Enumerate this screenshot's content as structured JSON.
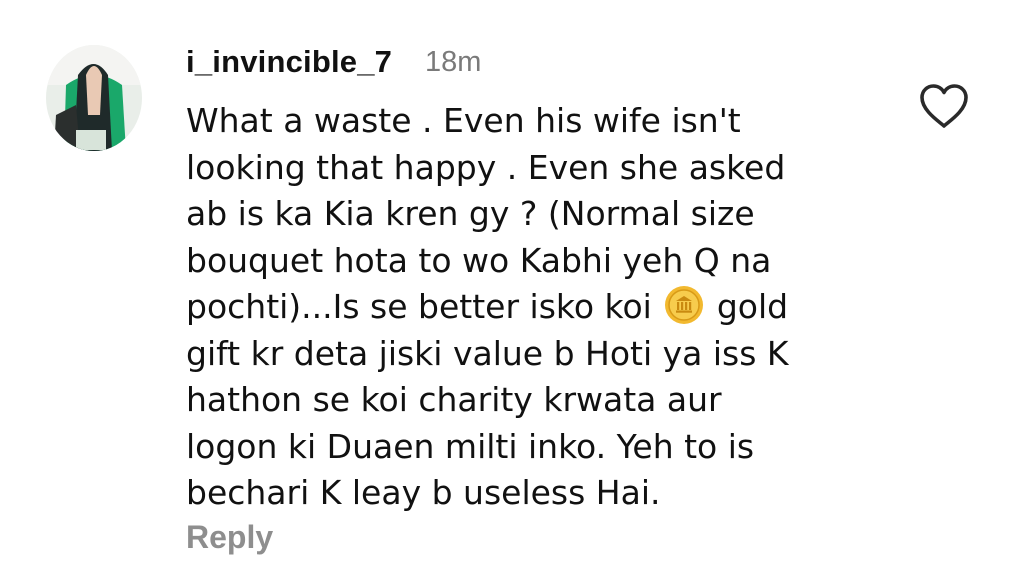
{
  "comment": {
    "username": "i_invincible_7",
    "timestamp": "18m",
    "lines": {
      "l1": "What a waste . Even his wife isn't",
      "l2": "looking that happy . Even she asked",
      "l3": "ab is ka Kia kren gy ? (Normal size",
      "l4": "bouquet hota to wo Kabhi yeh Q na",
      "l5a": "pochti)...Is se better isko koi",
      "l5b": "gold",
      "l6": "gift kr deta jiski value b Hoti ya iss K",
      "l7": "hathon se koi charity krwata aur",
      "l8": "logon ki Duaen milti inko. Yeh to is",
      "l9": "bechari K leay b useless Hai."
    },
    "inline_emoji": "coin-emoji",
    "reply_label": "Reply",
    "like_icon": "heart-outline-icon"
  },
  "colors": {
    "username": "#111111",
    "timestamp": "#7a7a7a",
    "reply": "#8e8e8e",
    "coin": "#f2b92f"
  }
}
